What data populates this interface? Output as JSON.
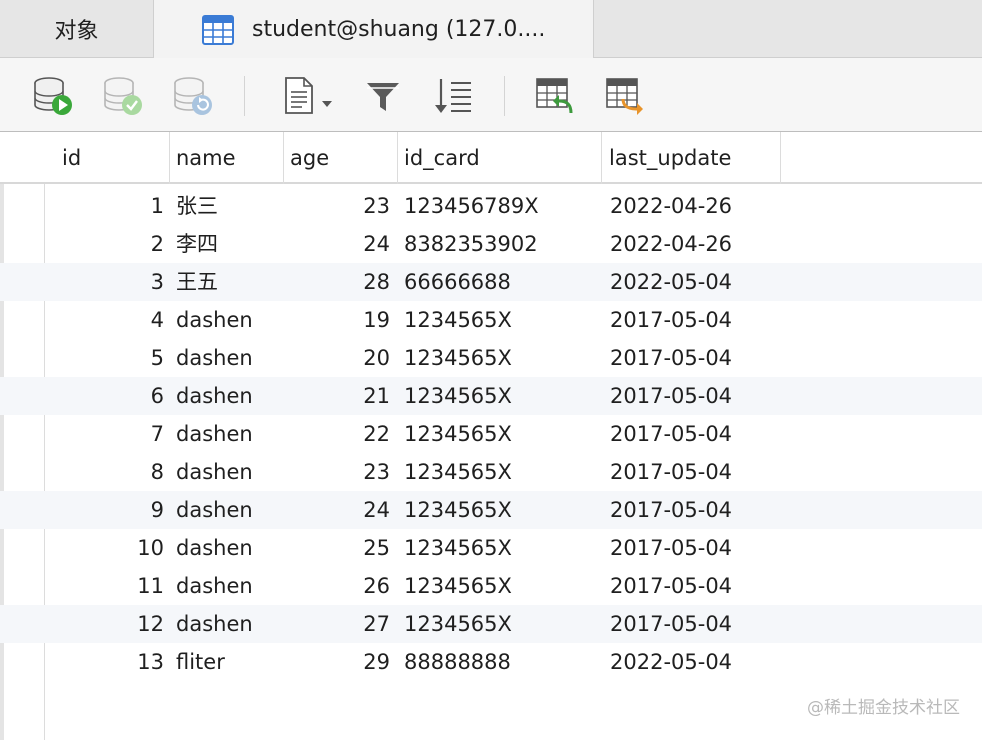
{
  "tabs": {
    "objects_label": "对象",
    "active_label": "student@shuang (127.0...."
  },
  "toolbar": {
    "buttons": [
      {
        "icon": "db-run-icon"
      },
      {
        "icon": "db-commit-icon"
      },
      {
        "icon": "db-rollback-icon"
      },
      {
        "icon": "text-document-icon"
      },
      {
        "icon": "filter-icon"
      },
      {
        "icon": "sort-icon"
      },
      {
        "icon": "import-table-icon"
      },
      {
        "icon": "export-table-icon"
      }
    ]
  },
  "table": {
    "columns": [
      "id",
      "name",
      "age",
      "id_card",
      "last_update"
    ],
    "rows": [
      {
        "id": "1",
        "name": "张三",
        "age": "23",
        "id_card": "123456789X",
        "last_update": "2022-04-26"
      },
      {
        "id": "2",
        "name": "李四",
        "age": "24",
        "id_card": "8382353902",
        "last_update": "2022-04-26"
      },
      {
        "id": "3",
        "name": "王五",
        "age": "28",
        "id_card": "66666688",
        "last_update": "2022-05-04"
      },
      {
        "id": "4",
        "name": "dashen",
        "age": "19",
        "id_card": "1234565X",
        "last_update": "2017-05-04"
      },
      {
        "id": "5",
        "name": "dashen",
        "age": "20",
        "id_card": "1234565X",
        "last_update": "2017-05-04"
      },
      {
        "id": "6",
        "name": "dashen",
        "age": "21",
        "id_card": "1234565X",
        "last_update": "2017-05-04"
      },
      {
        "id": "7",
        "name": "dashen",
        "age": "22",
        "id_card": "1234565X",
        "last_update": "2017-05-04"
      },
      {
        "id": "8",
        "name": "dashen",
        "age": "23",
        "id_card": "1234565X",
        "last_update": "2017-05-04"
      },
      {
        "id": "9",
        "name": "dashen",
        "age": "24",
        "id_card": "1234565X",
        "last_update": "2017-05-04"
      },
      {
        "id": "10",
        "name": "dashen",
        "age": "25",
        "id_card": "1234565X",
        "last_update": "2017-05-04"
      },
      {
        "id": "11",
        "name": "dashen",
        "age": "26",
        "id_card": "1234565X",
        "last_update": "2017-05-04"
      },
      {
        "id": "12",
        "name": "dashen",
        "age": "27",
        "id_card": "1234565X",
        "last_update": "2017-05-04"
      },
      {
        "id": "13",
        "name": "fliter",
        "age": "29",
        "id_card": "88888888",
        "last_update": "2022-05-04"
      }
    ]
  },
  "watermark": "@稀土掘金技术社区",
  "colors": {
    "run_green": "#3aa83a",
    "filter_gray": "#555555",
    "export_orange": "#e8942b",
    "import_green": "#3d9a3d",
    "tab_icon_blue": "#3a7bd5"
  }
}
